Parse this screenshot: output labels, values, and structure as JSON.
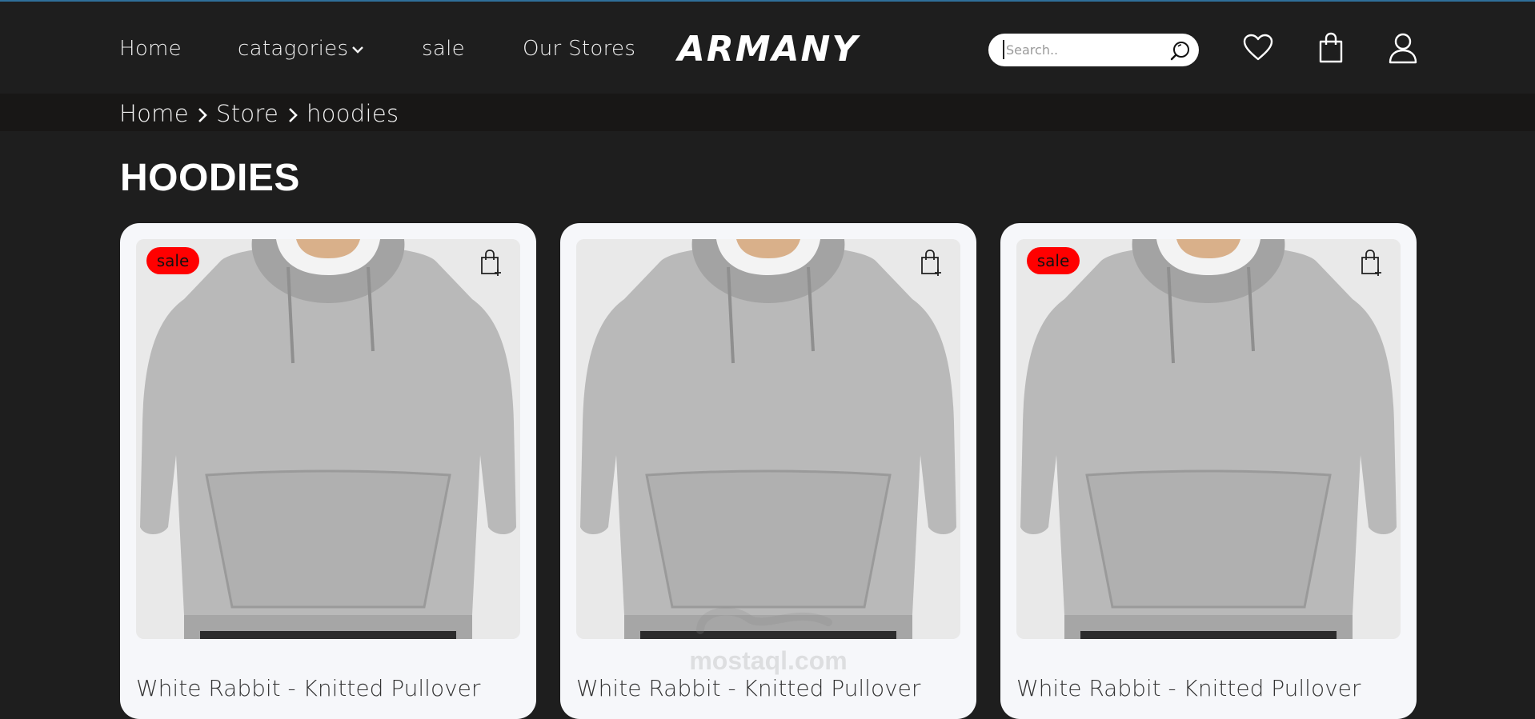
{
  "nav": {
    "links": [
      "Home",
      "catagories",
      "sale",
      "Our Stores"
    ]
  },
  "brand": {
    "logo_text": "ARMANY"
  },
  "search": {
    "placeholder": "Search.."
  },
  "header_icons": [
    "heart-icon",
    "shopping-bag-icon",
    "user-icon"
  ],
  "breadcrumb": [
    "Home",
    "Store",
    "hoodies"
  ],
  "page": {
    "title": "HOODIES"
  },
  "products": [
    {
      "badge": "sale",
      "title": "White Rabbit - Knitted Pullover"
    },
    {
      "badge": "",
      "title": "White Rabbit - Knitted Pullover"
    },
    {
      "badge": "sale",
      "title": "White Rabbit - Knitted Pullover"
    }
  ],
  "watermark": {
    "text": "mostaql.com"
  },
  "colors": {
    "background": "#1e1e1e",
    "breadcrumb_bg": "#181716",
    "card_bg": "#f6f7fa",
    "sale_badge": "#ff0000",
    "top_line": "#2f6f9a"
  }
}
